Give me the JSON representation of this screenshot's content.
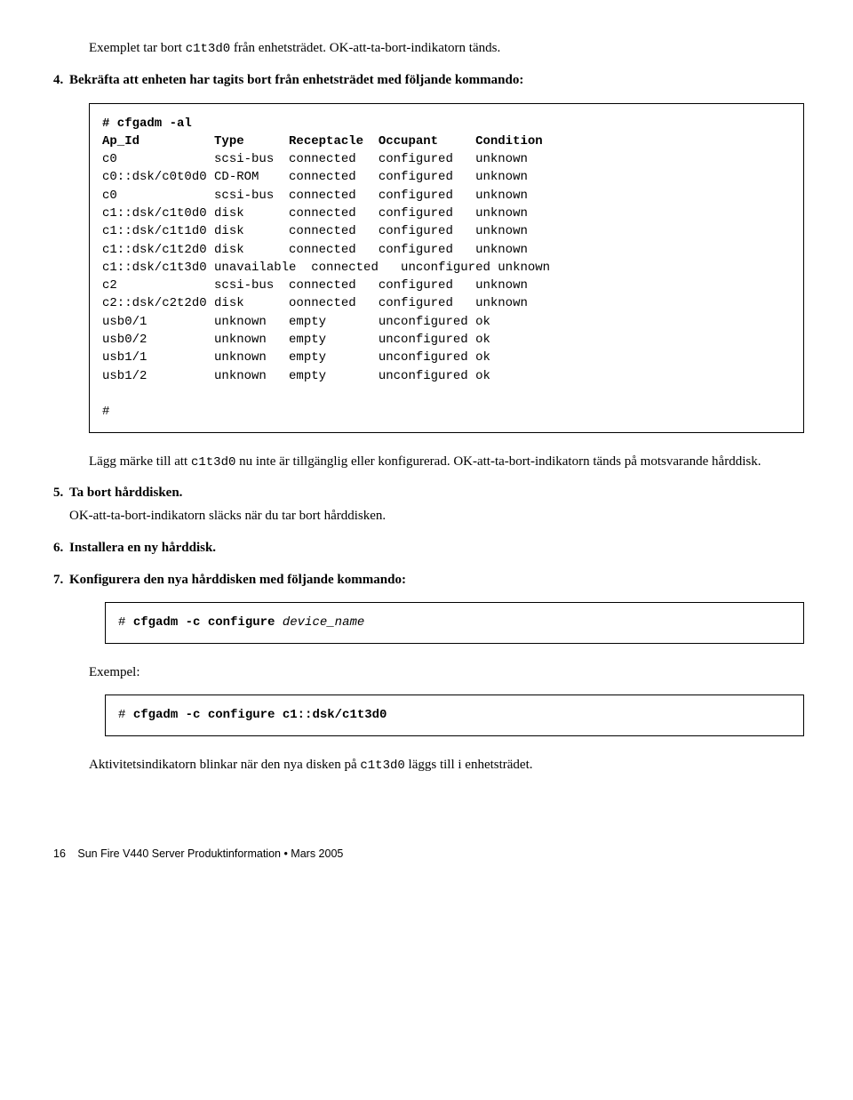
{
  "intro_before": "Exemplet tar bort ",
  "intro_code": "c1t3d0",
  "intro_after": " från enhetsträdet. OK-att-ta-bort-indikatorn tänds.",
  "step4_num": "4.",
  "step4_text": "Bekräfta att enheten har tagits bort från enhetsträdet med följande kommando:",
  "box1": {
    "cmd": "# cfgadm -al",
    "header": "Ap_Id          Type      Receptacle  Occupant     Condition",
    "rows": [
      "c0             scsi-bus  connected   configured   unknown",
      "c0::dsk/c0t0d0 CD-ROM    connected   configured   unknown",
      "c0             scsi-bus  connected   configured   unknown",
      "c1::dsk/c1t0d0 disk      connected   configured   unknown",
      "c1::dsk/c1t1d0 disk      connected   configured   unknown",
      "c1::dsk/c1t2d0 disk      connected   configured   unknown",
      "c1::dsk/c1t3d0 unavailable  connected   unconfigured unknown",
      "c2             scsi-bus  connected   configured   unknown",
      "c2::dsk/c2t2d0 disk      oonnected   configured   unknown",
      "usb0/1         unknown   empty       unconfigured ok",
      "usb0/2         unknown   empty       unconfigured ok",
      "usb1/1         unknown   empty       unconfigured ok",
      "usb1/2         unknown   empty       unconfigured ok"
    ],
    "tail": "#"
  },
  "note_before": "Lägg märke till att ",
  "note_code": "c1t3d0",
  "note_after": " nu inte är tillgänglig eller konfigurerad. OK-att-ta-bort-indikatorn tänds på motsvarande hårddisk.",
  "step5_num": "5.",
  "step5_text": "Ta bort hårddisken.",
  "step5_sub": "OK-att-ta-bort-indikatorn släcks när du tar bort hårddisken.",
  "step6_num": "6.",
  "step6_text": "Installera en ny hårddisk.",
  "step7_num": "7.",
  "step7_text": "Konfigurera den nya hårddisken med följande kommando:",
  "box2_prefix": "# ",
  "box2_bold": "cfgadm -c configure",
  "box2_italic": " device_name",
  "exempel": "Exempel:",
  "box3_prefix": "# ",
  "box3_bold": "cfgadm -c configure c1::dsk/c1t3d0",
  "final_before": "Aktivitetsindikatorn blinkar när den nya disken på ",
  "final_code": "c1t3d0",
  "final_after": " läggs till i enhetsträdet.",
  "footer_page": "16",
  "footer_text": "Sun Fire V440 Server Produktinformation • Mars 2005"
}
